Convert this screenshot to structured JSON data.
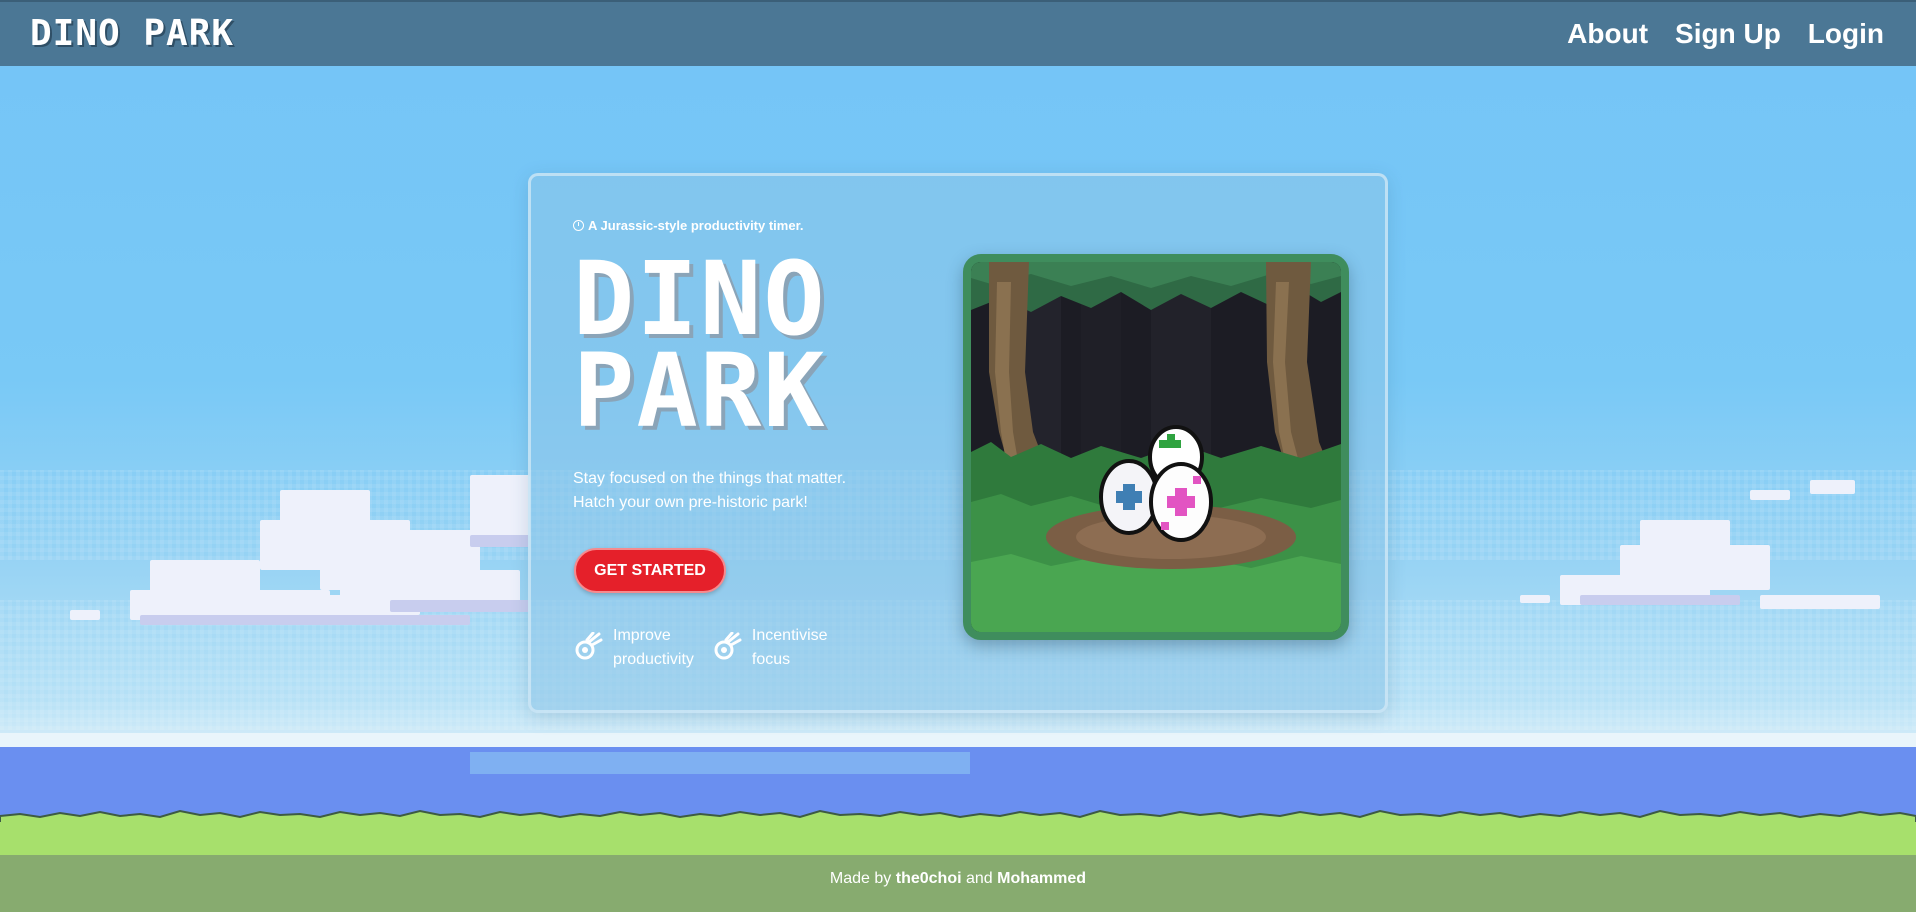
{
  "navbar": {
    "brand": "DINO PARK",
    "links": [
      {
        "label": "About"
      },
      {
        "label": "Sign Up"
      },
      {
        "label": "Login"
      }
    ]
  },
  "hero": {
    "tagline": "A Jurassic-style productivity timer.",
    "title_line1": "DINO",
    "title_line2": "PARK",
    "subtitle_line1": "Stay focused on the things that matter.",
    "subtitle_line2": "Hatch your own pre-historic park!",
    "cta_label": "GET STARTED",
    "features": [
      {
        "icon": "meteor-icon",
        "line1": "Improve",
        "line2": "productivity"
      },
      {
        "icon": "meteor-icon",
        "line1": "Incentivise",
        "line2": "focus"
      }
    ],
    "image": {
      "icon": "dino-eggs-forest-illustration"
    }
  },
  "footer": {
    "prefix": "Made by",
    "author1": "the0choi",
    "conjunction": "and",
    "author2": "Mohammed"
  },
  "colors": {
    "navbar": "#4b7795",
    "sky": "#79c6f6",
    "cta": "#e5202a",
    "water": "#6a8ff0",
    "grass": "#a7e06c",
    "ground": "#87ab6f",
    "image_border": "#3f8d5d"
  }
}
